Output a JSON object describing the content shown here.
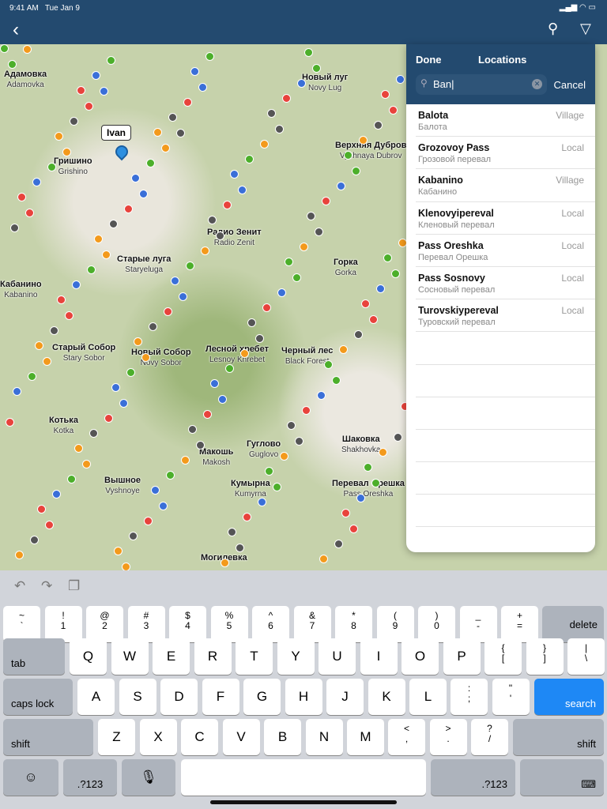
{
  "status": {
    "time": "9:41 AM",
    "date": "Tue Jan 9"
  },
  "nav": {
    "back_icon": "chevron-left-icon",
    "search_icon": "search-icon",
    "filter_icon": "filter-icon"
  },
  "map": {
    "marker_label": "Ivan",
    "labels": [
      {
        "ru": "Адамовка",
        "en": "Adamovka"
      },
      {
        "ru": "Гришино",
        "en": "Grishino"
      },
      {
        "ru": "Новый луг",
        "en": "Novy Lug"
      },
      {
        "ru": "Верхняя Дубров",
        "en": "Vyshnaya Dubrov"
      },
      {
        "ru": "Радио Зенит",
        "en": "Radio Zenit"
      },
      {
        "ru": "Старые луга",
        "en": "Staryeluga"
      },
      {
        "ru": "Кабанино",
        "en": "Kabanino"
      },
      {
        "ru": "Горка",
        "en": "Gorka"
      },
      {
        "ru": "Старый Собор",
        "en": "Stary Sobor"
      },
      {
        "ru": "Новый Собор",
        "en": "Novy Sobor"
      },
      {
        "ru": "Лесной хребет",
        "en": "Lesnoy Khrebet"
      },
      {
        "ru": "Черный лес",
        "en": "Black Forest"
      },
      {
        "ru": "Котька",
        "en": "Kotka"
      },
      {
        "ru": "Гуглово",
        "en": "Guglovo"
      },
      {
        "ru": "Шаковка",
        "en": "Shakhovka"
      },
      {
        "ru": "Макошь",
        "en": "Makosh"
      },
      {
        "ru": "Вышное",
        "en": "Vyshnoye"
      },
      {
        "ru": "Кумырна",
        "en": "Kumyrna"
      },
      {
        "ru": "Перевал Орешка",
        "en": "Pass Oreshka"
      },
      {
        "ru": "Могилевка",
        "en": ""
      }
    ]
  },
  "panel": {
    "done": "Done",
    "title": "Locations",
    "search_value": "Ban",
    "cancel": "Cancel",
    "results": [
      {
        "name": "Balota",
        "ru": "Балота",
        "type": "Village"
      },
      {
        "name": "Grozovoy Pass",
        "ru": "Грозовой перевал",
        "type": "Local"
      },
      {
        "name": "Kabanino",
        "ru": "Кабанино",
        "type": "Village"
      },
      {
        "name": "Klenovyipereval",
        "ru": "Кленовый перевал",
        "type": "Local"
      },
      {
        "name": "Pass Oreshka",
        "ru": "Перевал Орешка",
        "type": "Local"
      },
      {
        "name": "Pass Sosnovy",
        "ru": "Сосновый перевал",
        "type": "Local"
      },
      {
        "name": "Turovskiypereval",
        "ru": "Туровский перевал",
        "type": "Local"
      }
    ]
  },
  "keyboard": {
    "row1": [
      [
        "~",
        "`"
      ],
      [
        "!",
        "1"
      ],
      [
        "@",
        "2"
      ],
      [
        "#",
        "3"
      ],
      [
        "$",
        "4"
      ],
      [
        "%",
        "5"
      ],
      [
        "^",
        "6"
      ],
      [
        "&",
        "7"
      ],
      [
        "*",
        "8"
      ],
      [
        "(",
        "9"
      ],
      [
        ")",
        "0"
      ],
      [
        "_",
        "-"
      ],
      [
        "+",
        "="
      ]
    ],
    "delete": "delete",
    "tab": "tab",
    "row2": [
      "Q",
      "W",
      "E",
      "R",
      "T",
      "Y",
      "U",
      "I",
      "O",
      "P"
    ],
    "row2b": [
      [
        "{",
        "["
      ],
      [
        "}",
        "]"
      ],
      [
        "|",
        "\\"
      ]
    ],
    "caps": "caps lock",
    "row3": [
      "A",
      "S",
      "D",
      "F",
      "G",
      "H",
      "J",
      "K",
      "L"
    ],
    "row3b": [
      [
        ":",
        ";"
      ],
      [
        "\"",
        "'"
      ]
    ],
    "search": "search",
    "shift": "shift",
    "row4": [
      "Z",
      "X",
      "C",
      "V",
      "B",
      "N",
      "M"
    ],
    "row4b": [
      [
        "<",
        ","
      ],
      [
        ">",
        "."
      ],
      [
        "?",
        "/"
      ]
    ],
    "num": ".?123"
  }
}
